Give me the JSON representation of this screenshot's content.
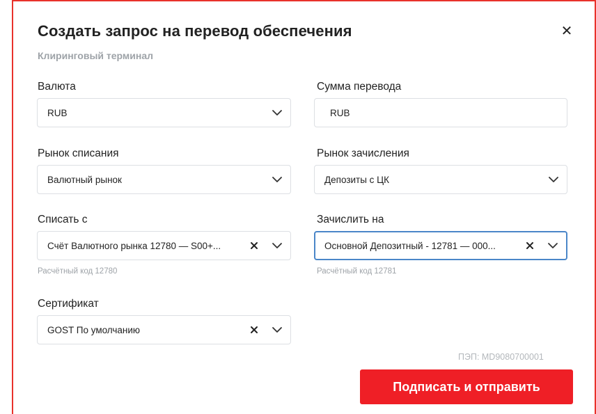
{
  "dialog": {
    "title": "Создать запрос на перевод обеспечения",
    "subtitle": "Клиринговый терминал"
  },
  "fields": {
    "currency": {
      "label": "Валюта",
      "value": "RUB"
    },
    "amount": {
      "label": "Сумма перевода",
      "value": "RUB"
    },
    "debit_market": {
      "label": "Рынок списания",
      "value": "Валютный рынок"
    },
    "credit_market": {
      "label": "Рынок зачисления",
      "value": "Депозиты с ЦК"
    },
    "debit_from": {
      "label": "Списать с",
      "value": "Счёт Валютного рынка 12780 — S00+...",
      "hint": "Расчётный код 12780"
    },
    "credit_to": {
      "label": "Зачислить на",
      "value": "Основной Депозитный - 12781 — 000...",
      "hint": "Расчётный код 12781"
    },
    "certificate": {
      "label": "Сертификат",
      "value": "GOST По умолчанию"
    }
  },
  "pep": "ПЭП: MD9080700001",
  "submit_label": "Подписать и отправить",
  "icons": {
    "close": "close-icon",
    "chevron": "chevron-down-icon",
    "clear": "clear-icon"
  },
  "colors": {
    "accent": "#ef1f26",
    "focus": "#4a86c8"
  }
}
